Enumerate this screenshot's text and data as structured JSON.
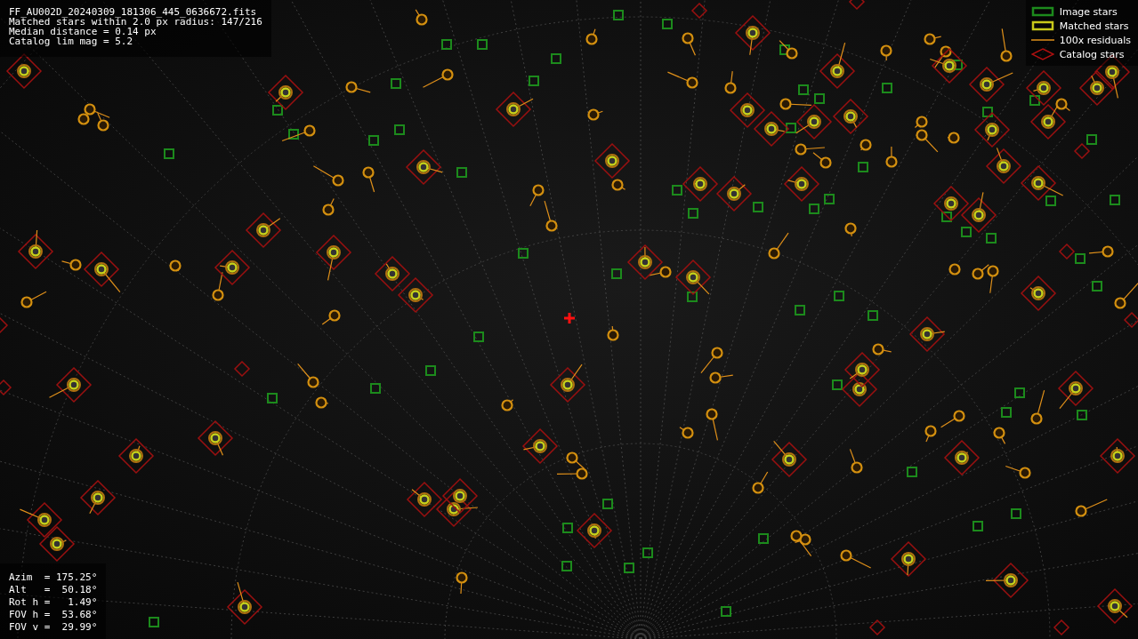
{
  "info": [
    "FF_AU002D_20240309_181306_445_0636672.fits",
    "Matched stars within 2.0 px radius: 147/216",
    "Median distance = 0.14 px",
    "Catalog lim mag = 5.2"
  ],
  "legend": [
    {
      "kind": "image",
      "label": "Image stars"
    },
    {
      "kind": "matched",
      "label": "Matched stars"
    },
    {
      "kind": "residual",
      "label": "100x residuals"
    },
    {
      "kind": "catalog",
      "label": "Catalog stars"
    }
  ],
  "pointing": [
    "Azim  = 175.25°",
    "Alt   =  50.18°",
    "Rot h =   1.49°",
    "FOV h =  53.68°",
    "FOV v =  29.99°"
  ]
}
